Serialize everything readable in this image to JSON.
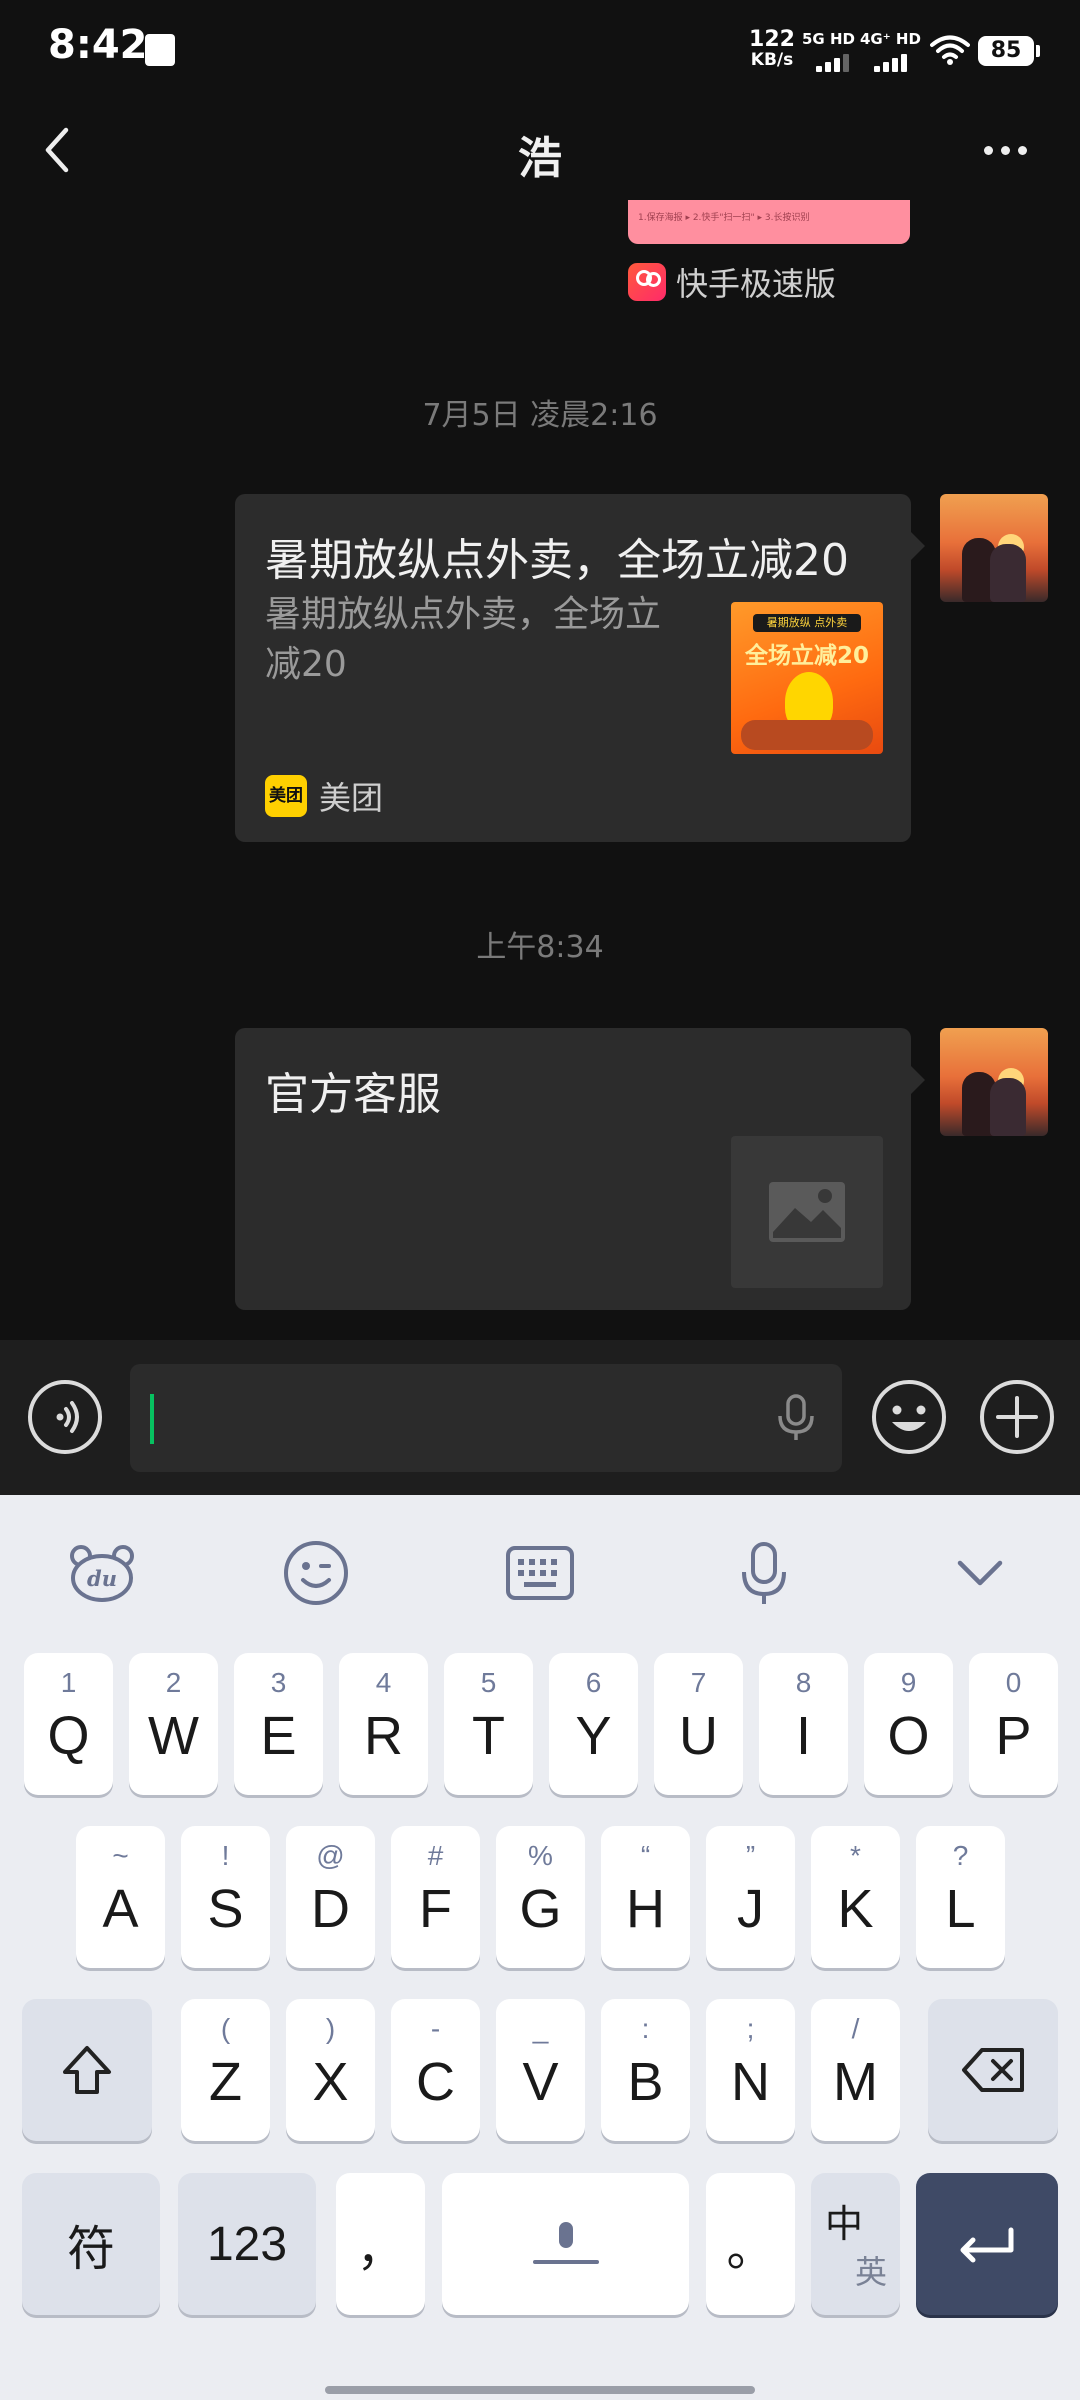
{
  "status_bar": {
    "time": "8:42",
    "net_speed_value": "122",
    "net_speed_unit": "KB/s",
    "sim1_label": "5G HD",
    "sim2_label": "4G⁺ HD",
    "battery": "85"
  },
  "nav": {
    "title": "浩"
  },
  "chat": {
    "partial_card_strip": "1.保存海报  ▸  2.快手\"扫一扫\"  ▸  3.长按识别",
    "partial_card_source": "快手极速版",
    "messages": [
      {
        "timestamp": "7月5日 凌晨2:16",
        "title": "暑期放纵点外卖，全场立减20",
        "desc": "暑期放纵点外卖，全场立减20",
        "thumb_tag": "暑期放纵 点外卖",
        "thumb_text": "全场立减20",
        "source": "美团",
        "source_logo_text": "美团"
      },
      {
        "timestamp": "上午8:34",
        "title": "官方客服",
        "desc": ""
      }
    ]
  },
  "keyboard": {
    "row1": [
      {
        "hint": "1",
        "key": "Q"
      },
      {
        "hint": "2",
        "key": "W"
      },
      {
        "hint": "3",
        "key": "E"
      },
      {
        "hint": "4",
        "key": "R"
      },
      {
        "hint": "5",
        "key": "T"
      },
      {
        "hint": "6",
        "key": "Y"
      },
      {
        "hint": "7",
        "key": "U"
      },
      {
        "hint": "8",
        "key": "I"
      },
      {
        "hint": "9",
        "key": "O"
      },
      {
        "hint": "0",
        "key": "P"
      }
    ],
    "row2": [
      {
        "hint": "~",
        "key": "A"
      },
      {
        "hint": "!",
        "key": "S"
      },
      {
        "hint": "@",
        "key": "D"
      },
      {
        "hint": "#",
        "key": "F"
      },
      {
        "hint": "%",
        "key": "G"
      },
      {
        "hint": "“",
        "key": "H"
      },
      {
        "hint": "”",
        "key": "J"
      },
      {
        "hint": "*",
        "key": "K"
      },
      {
        "hint": "?",
        "key": "L"
      }
    ],
    "row3": [
      {
        "hint": "(",
        "key": "Z"
      },
      {
        "hint": ")",
        "key": "X"
      },
      {
        "hint": "-",
        "key": "C"
      },
      {
        "hint": "_",
        "key": "V"
      },
      {
        "hint": ":",
        "key": "B"
      },
      {
        "hint": ";",
        "key": "N"
      },
      {
        "hint": "/",
        "key": "M"
      }
    ],
    "symbol_key": "符",
    "num_key": "123",
    "comma_key": "，",
    "period_key": "。",
    "lang_key_top": "中",
    "lang_key_bottom": "英"
  },
  "icons": {
    "accent": "#07c160",
    "enter_key_color": "#3f4a66"
  }
}
